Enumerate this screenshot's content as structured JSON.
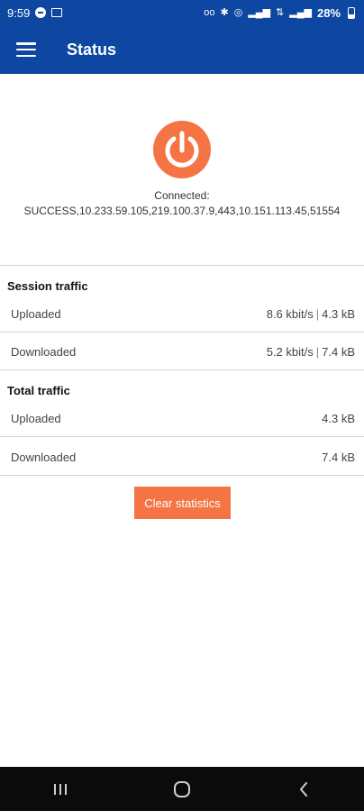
{
  "status_bar": {
    "time": "9:59",
    "battery": "28%",
    "icons": [
      "notification-dot-icon",
      "picture-icon",
      "voicemail-icon",
      "bluetooth-icon",
      "hotspot-icon",
      "signal-icon",
      "data-icon",
      "signal-icon",
      "battery-icon"
    ]
  },
  "app_bar": {
    "title": "Status",
    "menu_icon": "hamburger-menu-icon"
  },
  "connection": {
    "power_icon": "power-icon",
    "label": "Connected:",
    "detail": "SUCCESS,10.233.59.105,219.100.37.9,443,10.151.113.45,51554"
  },
  "session": {
    "title": "Session traffic",
    "uploaded_label": "Uploaded",
    "uploaded_rate": "8.6 kbit/s",
    "uploaded_total": "4.3 kB",
    "downloaded_label": "Downloaded",
    "downloaded_rate": "5.2 kbit/s",
    "downloaded_total": "7.4 kB"
  },
  "total": {
    "title": "Total traffic",
    "uploaded_label": "Uploaded",
    "uploaded_value": "4.3 kB",
    "downloaded_label": "Downloaded",
    "downloaded_value": "7.4 kB"
  },
  "actions": {
    "clear_label": "Clear statistics"
  },
  "nav_bar": {
    "icons": [
      "recent-apps-icon",
      "home-icon",
      "back-icon"
    ]
  },
  "colors": {
    "primary": "#0d47a1",
    "accent": "#f47443"
  }
}
